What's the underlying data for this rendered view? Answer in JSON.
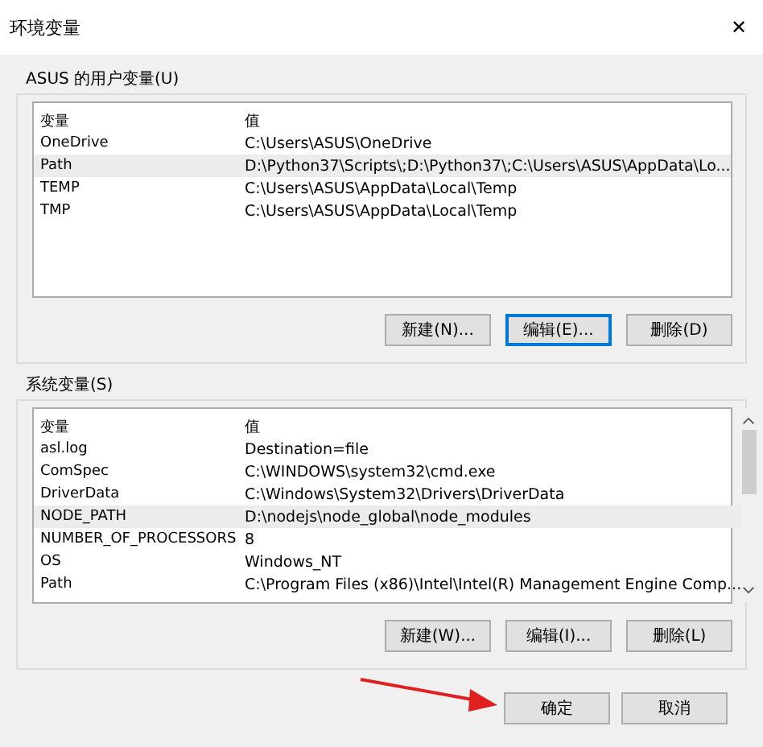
{
  "window": {
    "title": "环境变量",
    "close": "✕"
  },
  "groups": [
    {
      "label": "ASUS 的用户变量(U)",
      "columns": [
        "变量",
        "值"
      ],
      "scrollbar": false,
      "rows": [
        {
          "name": "OneDrive",
          "value": "C:\\Users\\ASUS\\OneDrive",
          "selected": false
        },
        {
          "name": "Path",
          "value": "D:\\Python37\\Scripts\\;D:\\Python37\\;C:\\Users\\ASUS\\AppData\\Lo...",
          "selected": true
        },
        {
          "name": "TEMP",
          "value": "C:\\Users\\ASUS\\AppData\\Local\\Temp",
          "selected": false
        },
        {
          "name": "TMP",
          "value": "C:\\Users\\ASUS\\AppData\\Local\\Temp",
          "selected": false
        }
      ],
      "buttons": [
        {
          "label": "新建(N)...",
          "focused": false
        },
        {
          "label": "编辑(E)...",
          "focused": true
        },
        {
          "label": "删除(D)",
          "focused": false
        }
      ]
    },
    {
      "label": "系统变量(S)",
      "columns": [
        "变量",
        "值"
      ],
      "scrollbar": true,
      "rows": [
        {
          "name": "asl.log",
          "value": "Destination=file",
          "selected": false
        },
        {
          "name": "ComSpec",
          "value": "C:\\WINDOWS\\system32\\cmd.exe",
          "selected": false
        },
        {
          "name": "DriverData",
          "value": "C:\\Windows\\System32\\Drivers\\DriverData",
          "selected": false
        },
        {
          "name": "NODE_PATH",
          "value": "D:\\nodejs\\node_global\\node_modules",
          "selected": true
        },
        {
          "name": "NUMBER_OF_PROCESSORS",
          "value": "8",
          "selected": false
        },
        {
          "name": "OS",
          "value": "Windows_NT",
          "selected": false
        },
        {
          "name": "Path",
          "value": "C:\\Program Files (x86)\\Intel\\Intel(R) Management Engine Comp...",
          "selected": false
        }
      ],
      "buttons": [
        {
          "label": "新建(W)...",
          "focused": false
        },
        {
          "label": "编辑(I)...",
          "focused": false
        },
        {
          "label": "删除(L)",
          "focused": false
        }
      ]
    }
  ],
  "footer": [
    {
      "label": "确定",
      "focused": false
    },
    {
      "label": "取消",
      "focused": false
    }
  ],
  "annotation": {
    "kind": "arrow"
  }
}
